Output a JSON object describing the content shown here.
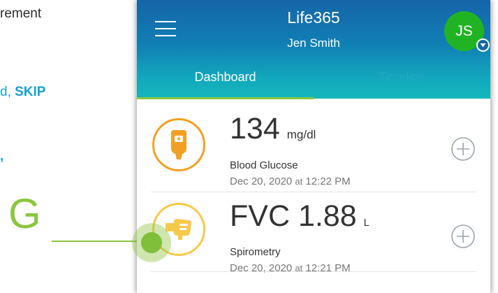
{
  "doc": {
    "line1": "rement",
    "line2_prefix": "d, ",
    "line2_bold": "SKIP",
    "line3": ","
  },
  "callout": {
    "letter": "G",
    "color": "#8cc63f"
  },
  "app": {
    "title": "Life365",
    "user_name": "Jen Smith",
    "avatar_initials": "JS",
    "tabs": [
      {
        "label": "Dashboard",
        "active": true
      },
      {
        "label": "Timeline",
        "active": false
      }
    ],
    "colors": {
      "header_top": "#1565a8",
      "header_bottom": "#14b7bb",
      "tab_indicator": "#8cc63f",
      "avatar": "#22b324",
      "glucose_accent": "#f2a023",
      "spirometry_accent": "#f7c94a"
    }
  },
  "readings": [
    {
      "value": "134",
      "unit": "mg/dl",
      "name": "Blood Glucose",
      "date": "Dec 20, 2020",
      "at": "at",
      "time": "12:22 PM",
      "icon": "glucose-meter-icon"
    },
    {
      "value": "FVC 1.88",
      "unit": "L",
      "name": "Spirometry",
      "date": "Dec 20, 2020",
      "at": "at",
      "time": "12:21 PM",
      "icon": "lungs-icon"
    }
  ]
}
